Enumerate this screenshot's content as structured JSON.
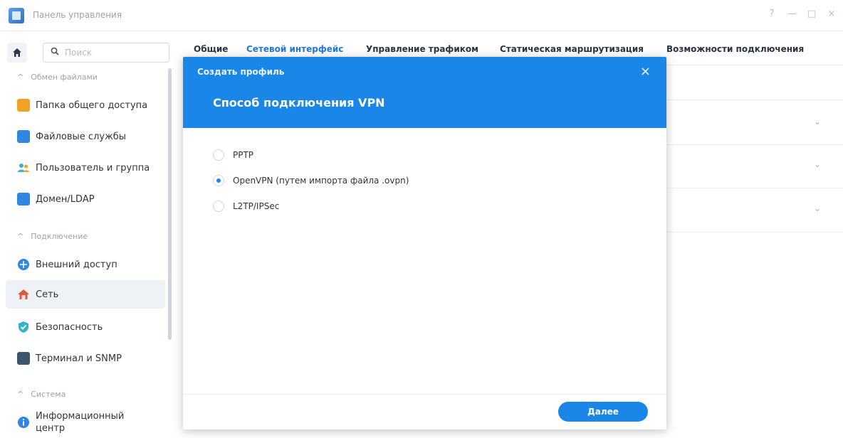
{
  "window": {
    "title": "Панель управления",
    "controls": [
      "?",
      "—",
      "□",
      "×"
    ]
  },
  "sidebar": {
    "search_placeholder": "Поиск",
    "sections": [
      {
        "label": "Обмен файлами",
        "items": [
          {
            "label": "Папка общего доступа",
            "icon": "shared-folder-icon",
            "color": "#f0a224"
          },
          {
            "label": "Файловые службы",
            "icon": "file-services-icon",
            "color": "#2f87e0"
          },
          {
            "label": "Пользователь и группа",
            "icon": "user-group-icon",
            "color": "#36b3c9"
          },
          {
            "label": "Домен/LDAP",
            "icon": "domain-ldap-icon",
            "color": "#2f87e0"
          }
        ]
      },
      {
        "label": "Подключение",
        "items": [
          {
            "label": "Внешний доступ",
            "icon": "external-access-icon",
            "color": "#2f87e0"
          },
          {
            "label": "Сеть",
            "icon": "network-icon",
            "color": "#e2573f",
            "active": true
          },
          {
            "label": "Безопасность",
            "icon": "security-shield-icon",
            "color": "#36b3c9"
          },
          {
            "label": "Терминал и SNMP",
            "icon": "terminal-icon",
            "color": "#3d5670"
          }
        ]
      },
      {
        "label": "Система",
        "items": [
          {
            "label": "Информационный центр",
            "icon": "info-center-icon",
            "color": "#2f87e0"
          }
        ]
      }
    ]
  },
  "tabs": [
    "Общие",
    "Сетевой интерфейс",
    "Управление трафиком",
    "Статическая маршрутизация",
    "Возможности подключения"
  ],
  "active_tab": "Сетевой интерфейс",
  "modal": {
    "title": "Создать профиль",
    "heading": "Способ подключения VPN",
    "options": [
      {
        "label": "PPTP",
        "checked": false
      },
      {
        "label": "OpenVPN (путем импорта файла .ovpn)",
        "checked": true
      },
      {
        "label": "L2TP/IPSec",
        "checked": false
      }
    ],
    "next_label": "Далее"
  },
  "colors": {
    "accent": "#1a86e8"
  }
}
